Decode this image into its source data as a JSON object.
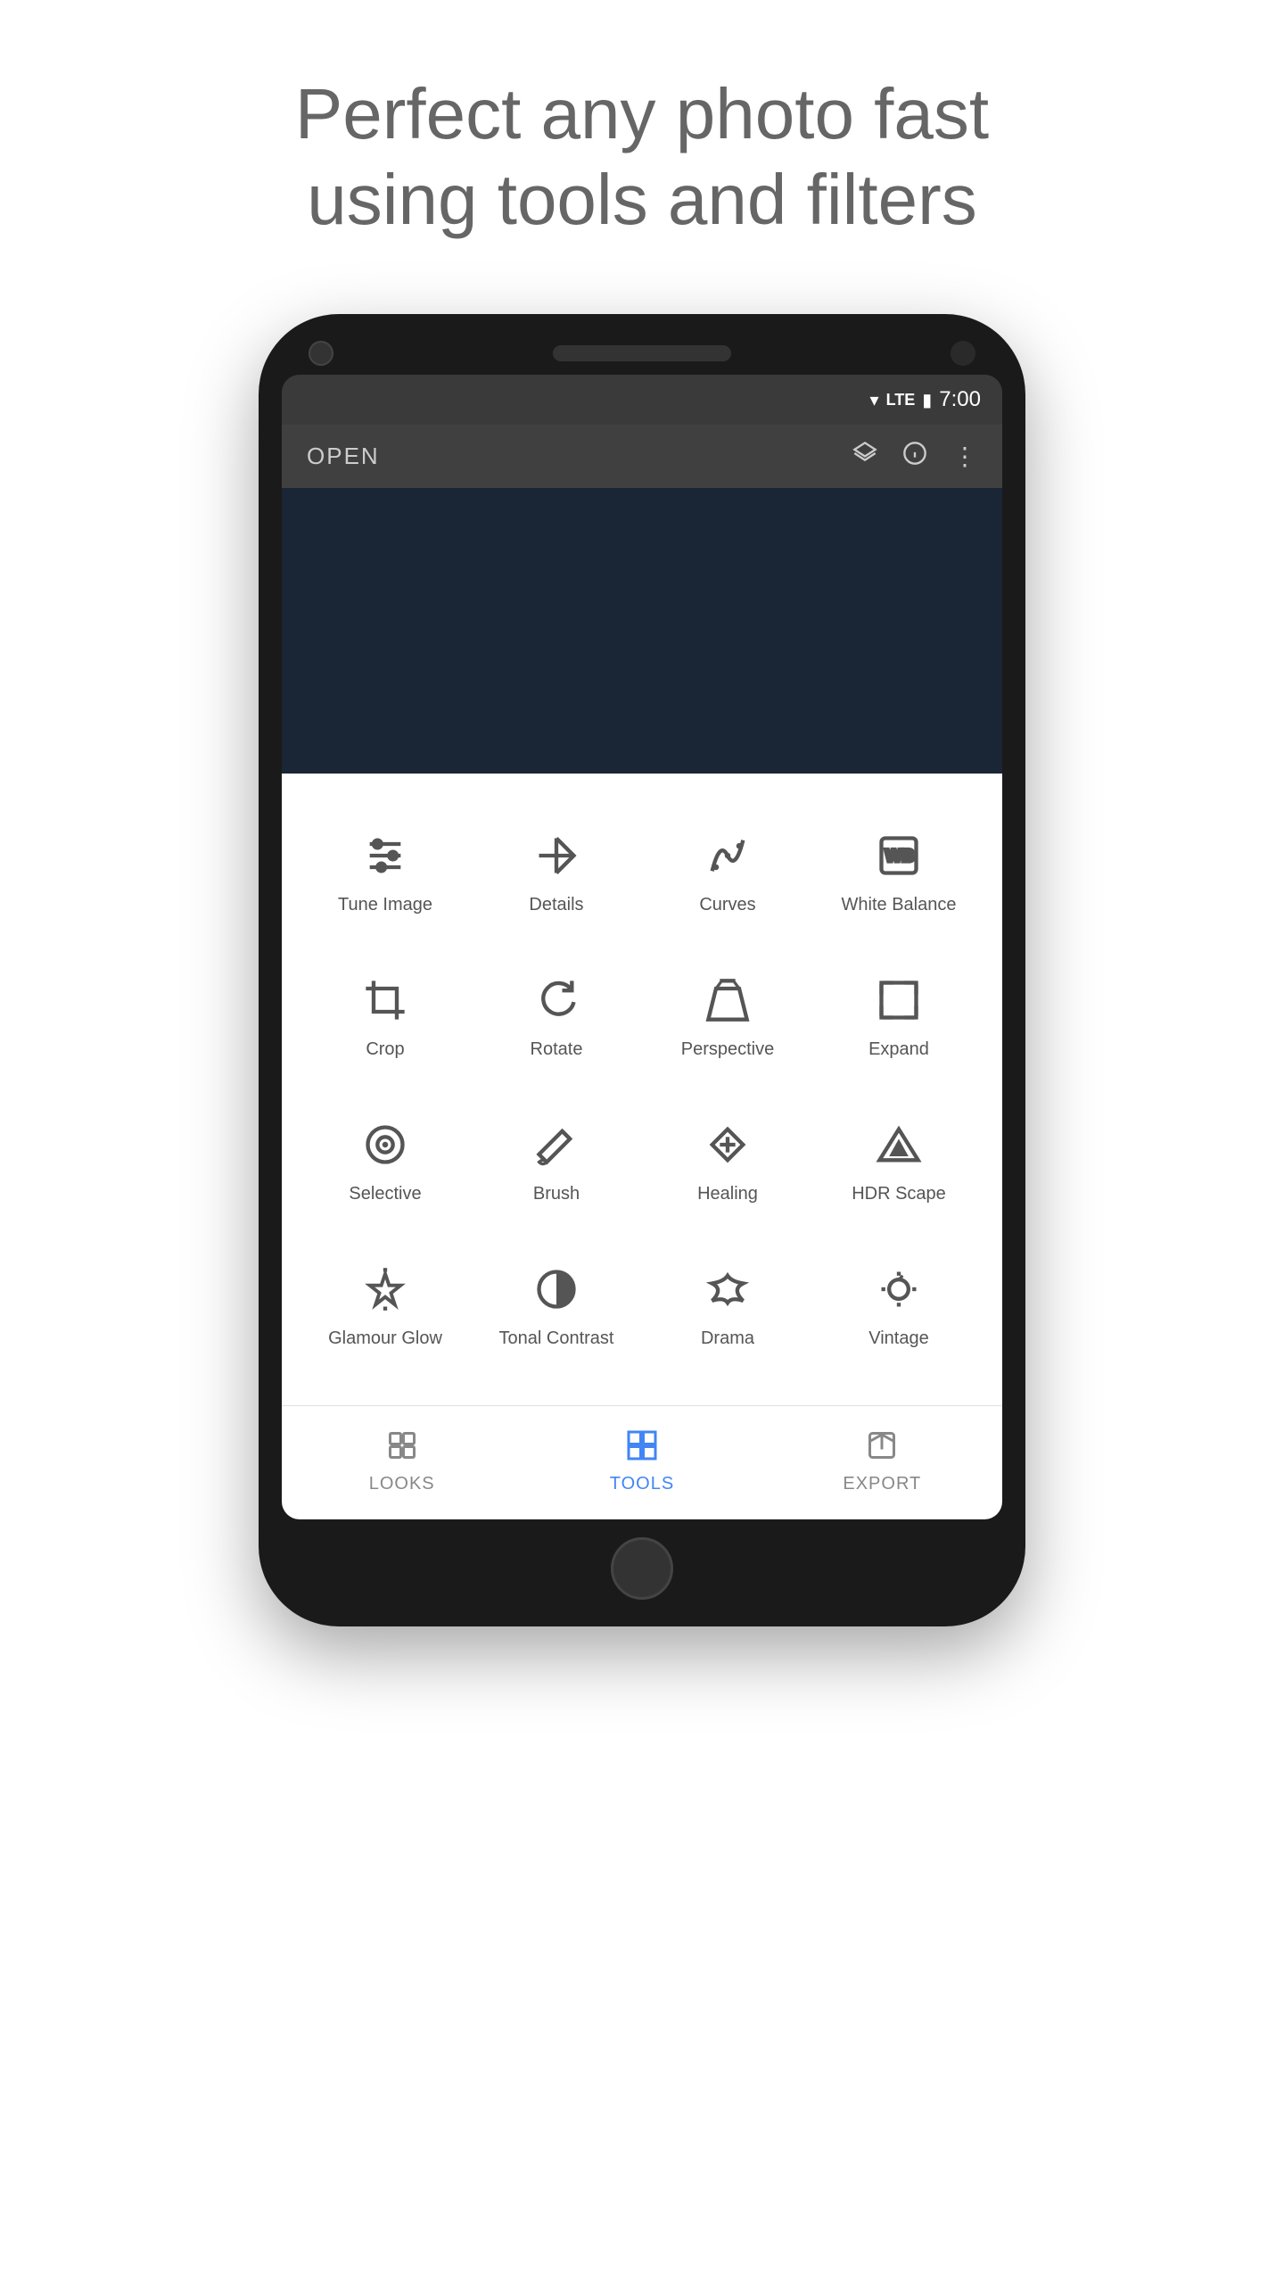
{
  "headline": {
    "line1": "Perfect any photo fast",
    "line2": "using tools and filters"
  },
  "status_bar": {
    "time": "7:00",
    "wifi": "▼",
    "lte": "LTE",
    "battery": "🔋"
  },
  "toolbar": {
    "open_label": "OPEN"
  },
  "tools": [
    {
      "id": "tune-image",
      "label": "Tune Image",
      "icon": "tune"
    },
    {
      "id": "details",
      "label": "Details",
      "icon": "details"
    },
    {
      "id": "curves",
      "label": "Curves",
      "icon": "curves"
    },
    {
      "id": "white-balance",
      "label": "White Balance",
      "icon": "wb"
    },
    {
      "id": "crop",
      "label": "Crop",
      "icon": "crop"
    },
    {
      "id": "rotate",
      "label": "Rotate",
      "icon": "rotate"
    },
    {
      "id": "perspective",
      "label": "Perspective",
      "icon": "perspective"
    },
    {
      "id": "expand",
      "label": "Expand",
      "icon": "expand"
    },
    {
      "id": "selective",
      "label": "Selective",
      "icon": "selective"
    },
    {
      "id": "brush",
      "label": "Brush",
      "icon": "brush"
    },
    {
      "id": "healing",
      "label": "Healing",
      "icon": "healing"
    },
    {
      "id": "hdr-scape",
      "label": "HDR Scape",
      "icon": "hdr"
    },
    {
      "id": "glamour-glow",
      "label": "Glamour Glow",
      "icon": "glamour"
    },
    {
      "id": "tonal-contrast",
      "label": "Tonal Contrast",
      "icon": "tonal"
    },
    {
      "id": "drama",
      "label": "Drama",
      "icon": "drama"
    },
    {
      "id": "vintage",
      "label": "Vintage",
      "icon": "vintage"
    }
  ],
  "bottom_nav": [
    {
      "id": "looks",
      "label": "LOOKS",
      "active": false
    },
    {
      "id": "tools",
      "label": "TOOLS",
      "active": true
    },
    {
      "id": "export",
      "label": "EXPORT",
      "active": false
    }
  ]
}
